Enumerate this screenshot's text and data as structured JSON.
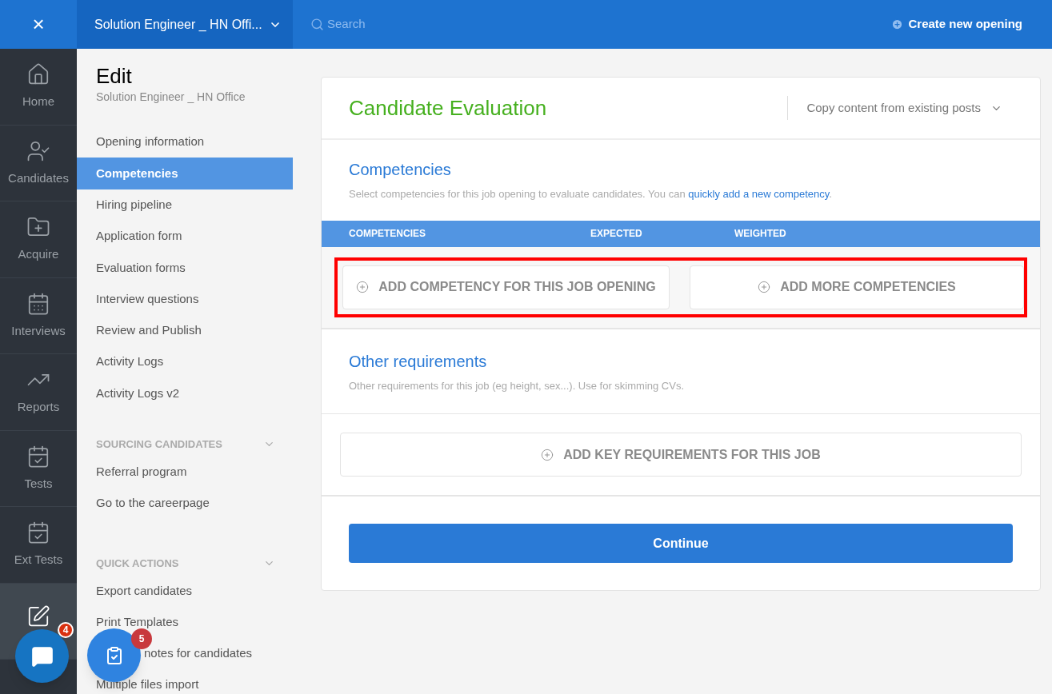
{
  "topbar": {
    "close": "×",
    "opening_title": "Solution Engineer _ HN Offi...",
    "search": {
      "placeholder": "Search"
    },
    "create": "Create new opening"
  },
  "rail": [
    {
      "label": "Home",
      "selected": false
    },
    {
      "label": "Candidates",
      "selected": false
    },
    {
      "label": "Acquire",
      "selected": false
    },
    {
      "label": "Interviews",
      "selected": false
    },
    {
      "label": "Reports",
      "selected": false
    },
    {
      "label": "Tests",
      "selected": false
    },
    {
      "label": "Ext Tests",
      "selected": false
    },
    {
      "selected": true
    }
  ],
  "sidebar": {
    "title": "Edit",
    "subtitle": "Solution Engineer _ HN Office",
    "items": [
      {
        "label": "Opening information",
        "selected": false
      },
      {
        "label": "Competencies",
        "selected": true
      },
      {
        "label": "Hiring pipeline",
        "selected": false
      },
      {
        "label": "Application form",
        "selected": false
      },
      {
        "label": "Evaluation forms",
        "selected": false
      },
      {
        "label": "Interview questions",
        "selected": false
      },
      {
        "label": "Review and Publish",
        "selected": false
      },
      {
        "label": "Activity Logs",
        "selected": false
      },
      {
        "label": "Activity Logs v2",
        "selected": false
      }
    ],
    "sections": [
      {
        "title": "SOURCING CANDIDATES",
        "expanded": true,
        "items": [
          {
            "label": "Referral program",
            "kind": "plain"
          },
          {
            "label": "Go to the careerpage",
            "kind": "plain"
          }
        ]
      },
      {
        "title": "QUICK ACTIONS",
        "expanded": true,
        "items": [
          {
            "label": "Export candidates",
            "kind": "plain"
          },
          {
            "label": "Print Templates",
            "kind": "plain"
          },
          {
            "label": "notes for candidates",
            "kind": "covered"
          },
          {
            "label": "Multiple files import",
            "kind": "plain"
          }
        ]
      }
    ]
  },
  "card": {
    "title": "Candidate Evaluation",
    "copy_dropdown": "Copy content from existing posts",
    "competencies": {
      "title": "Competencies",
      "description": "Select competencies for this job opening to evaluate candidates. You can ",
      "link": "quickly add a new competency",
      "description_end": ".",
      "columns": [
        "COMPETENCIES",
        "EXPECTED",
        "WEIGHTED"
      ],
      "buttons": [
        "ADD COMPETENCY FOR THIS JOB OPENING",
        "ADD MORE COMPETENCIES"
      ],
      "highlighted": true
    },
    "other": {
      "title": "Other requirements",
      "description": "Other requirements for this job (eg height, sex...). Use for skimming CVs.",
      "button": "ADD KEY REQUIREMENTS FOR THIS JOB"
    },
    "continue": "Continue"
  },
  "floating": [
    {
      "kind": "chat",
      "badge": "4"
    },
    {
      "kind": "tasks",
      "badge": "5"
    }
  ]
}
